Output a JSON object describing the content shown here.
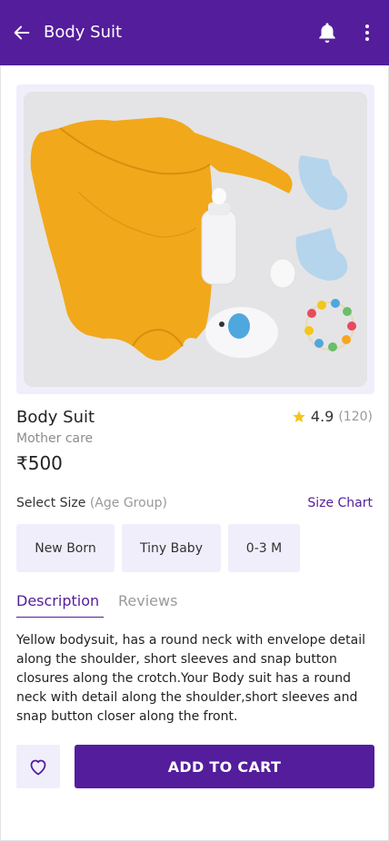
{
  "app_bar": {
    "title": "Body Suit",
    "icons": {
      "back": "arrow-left-icon",
      "notifications": "bell-icon",
      "more": "more-vertical-icon"
    },
    "background": "#541d9b"
  },
  "product": {
    "image_alt": "Yellow baby bodysuit with socks, bottle and toys",
    "name": "Body Suit",
    "category": "Mother care",
    "price": "₹500",
    "rating": "4.9",
    "rating_count": "(120)"
  },
  "sizes": {
    "label": "Select Size",
    "label_hint": "(Age Group)",
    "chart_link": "Size Chart",
    "options": [
      "New Born",
      "Tiny Baby",
      "0-3 M"
    ]
  },
  "tabs": {
    "description": "Description",
    "reviews": "Reviews",
    "active": "Description"
  },
  "description": "Yellow bodysuit, has a round neck with envelope detail along the shoulder, short sleeves and snap button closures along the crotch.Your Body suit has a round neck with detail along the shoulder,short sleeves and snap button closer along the front.",
  "actions": {
    "wishlist_icon": "heart-outline-icon",
    "add_to_cart": "ADD TO CART"
  },
  "colors": {
    "accent": "#541d9b",
    "chip_bg": "#f1eefb",
    "star": "#f5c518"
  }
}
